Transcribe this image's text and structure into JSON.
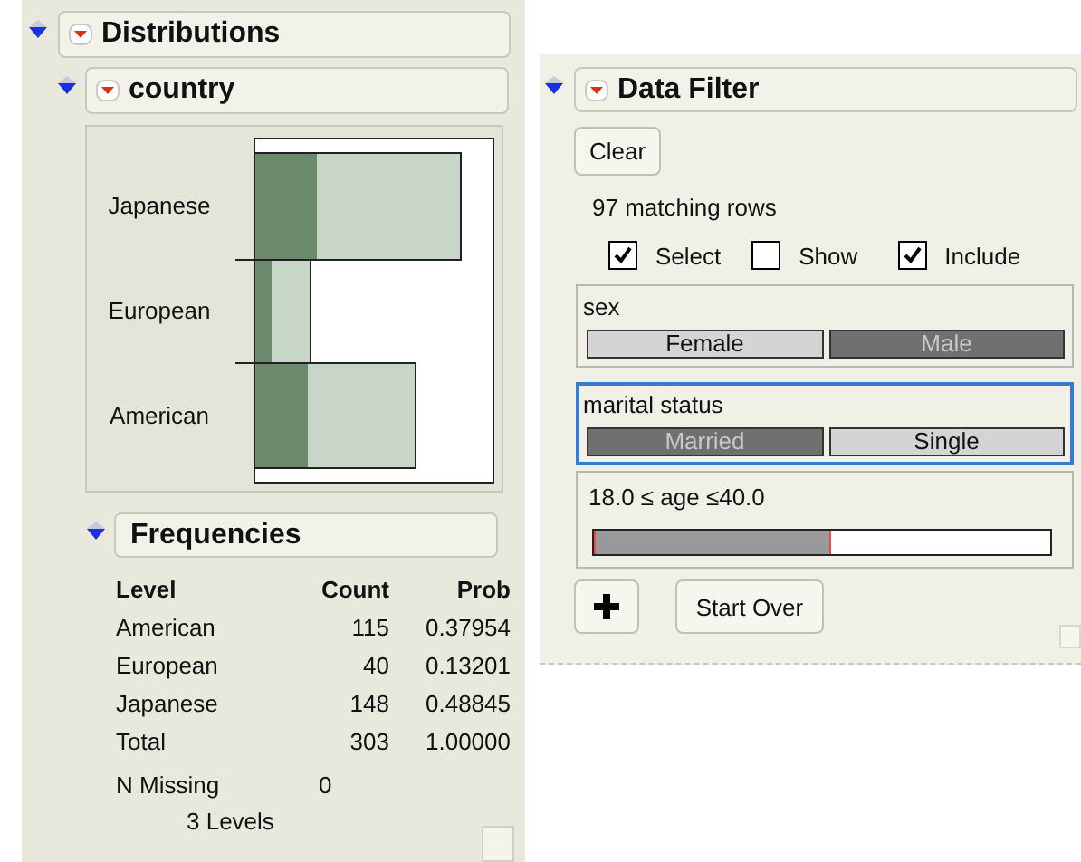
{
  "distributions": {
    "title": "Distributions",
    "variable": {
      "title": "country",
      "chart": {
        "bars": [
          {
            "label": "Japanese"
          },
          {
            "label": "European"
          },
          {
            "label": "American"
          }
        ]
      },
      "frequencies": {
        "title": "Frequencies",
        "columns": [
          "Level",
          "Count",
          "Prob"
        ],
        "rows": [
          [
            "American",
            "115",
            "0.37954"
          ],
          [
            "European",
            "40",
            "0.13201"
          ],
          [
            "Japanese",
            "148",
            "0.48845"
          ],
          [
            "Total",
            "303",
            "1.00000"
          ]
        ],
        "n_missing": {
          "label": "N Missing",
          "value": "0"
        },
        "levels": "3 Levels"
      }
    }
  },
  "data_filter": {
    "title": "Data Filter",
    "clear_button": "Clear",
    "matching_rows": "97 matching rows",
    "options": [
      {
        "label": "Select",
        "checked": true
      },
      {
        "label": "Show",
        "checked": false
      },
      {
        "label": "Include",
        "checked": true
      }
    ],
    "filters": [
      {
        "kind": "categorical",
        "name": "sex",
        "focused": false,
        "values": [
          {
            "label": "Female",
            "selected": false
          },
          {
            "label": "Male",
            "selected": true
          }
        ]
      },
      {
        "kind": "categorical",
        "name": "marital status",
        "focused": true,
        "values": [
          {
            "label": "Married",
            "selected": true
          },
          {
            "label": "Single",
            "selected": false
          }
        ]
      },
      {
        "kind": "range",
        "label": "18.0 ≤ age ≤40.0",
        "level": 0.52
      }
    ],
    "start_over_button": "Start Over"
  }
}
